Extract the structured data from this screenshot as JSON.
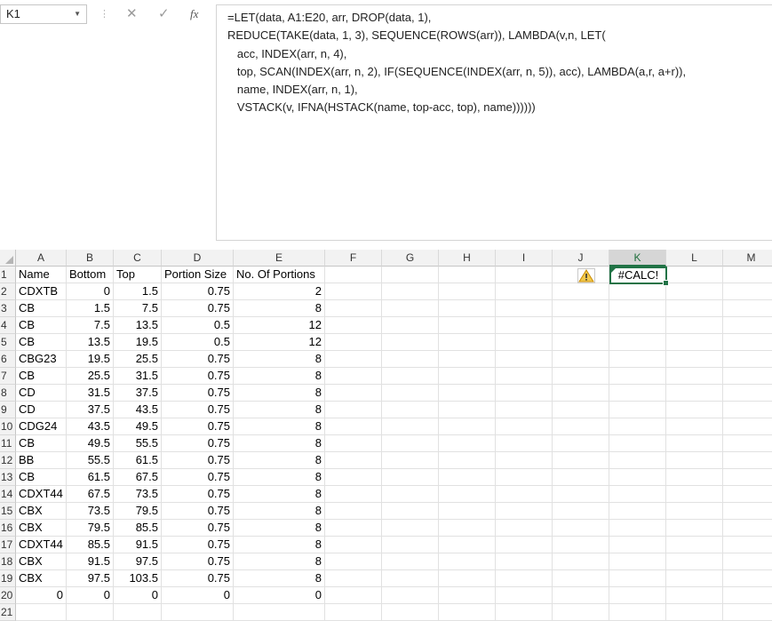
{
  "name_box": "K1",
  "formula_lines": [
    "=LET(data, A1:E20, arr, DROP(data, 1),",
    "REDUCE(TAKE(data, 1, 3), SEQUENCE(ROWS(arr)), LAMBDA(v,n, LET(",
    "   acc, INDEX(arr, n, 4),",
    "   top, SCAN(INDEX(arr, n, 2), IF(SEQUENCE(INDEX(arr, n, 5)), acc), LAMBDA(a,r, a+r)),",
    "   name, INDEX(arr, n, 1),",
    "   VSTACK(v, IFNA(HSTACK(name, top-acc, top), name))))))"
  ],
  "formula_icons": {
    "cancel": "✕",
    "enter": "✓",
    "fx": "fx"
  },
  "columns": [
    "A",
    "B",
    "C",
    "D",
    "E",
    "F",
    "G",
    "H",
    "I",
    "J",
    "K",
    "L",
    "M"
  ],
  "rows": [
    [
      "Name",
      "Bottom",
      "Top",
      "Portion Size",
      "No. Of Portions"
    ],
    [
      "CDXTB",
      "0",
      "1.5",
      "0.75",
      "2"
    ],
    [
      "CB",
      "1.5",
      "7.5",
      "0.75",
      "8"
    ],
    [
      "CB",
      "7.5",
      "13.5",
      "0.5",
      "12"
    ],
    [
      "CB",
      "13.5",
      "19.5",
      "0.5",
      "12"
    ],
    [
      "CBG23",
      "19.5",
      "25.5",
      "0.75",
      "8"
    ],
    [
      "CB",
      "25.5",
      "31.5",
      "0.75",
      "8"
    ],
    [
      "CD",
      "31.5",
      "37.5",
      "0.75",
      "8"
    ],
    [
      "CD",
      "37.5",
      "43.5",
      "0.75",
      "8"
    ],
    [
      "CDG24",
      "43.5",
      "49.5",
      "0.75",
      "8"
    ],
    [
      "CB",
      "49.5",
      "55.5",
      "0.75",
      "8"
    ],
    [
      "BB",
      "55.5",
      "61.5",
      "0.75",
      "8"
    ],
    [
      "CB",
      "61.5",
      "67.5",
      "0.75",
      "8"
    ],
    [
      "CDXT44",
      "67.5",
      "73.5",
      "0.75",
      "8"
    ],
    [
      "CBX",
      "73.5",
      "79.5",
      "0.75",
      "8"
    ],
    [
      "CBX",
      "79.5",
      "85.5",
      "0.75",
      "8"
    ],
    [
      "CDXT44",
      "85.5",
      "91.5",
      "0.75",
      "8"
    ],
    [
      "CBX",
      "91.5",
      "97.5",
      "0.75",
      "8"
    ],
    [
      "CBX",
      "97.5",
      "103.5",
      "0.75",
      "8"
    ],
    [
      "0",
      "0",
      "0",
      "0",
      "0"
    ],
    [
      "",
      "",
      "",
      "",
      ""
    ]
  ],
  "active_cell": {
    "ref": "K1",
    "value": "#CALC!"
  },
  "warning_icon": "warning-icon",
  "colors": {
    "accent": "#217346",
    "header_bg": "#f2f2f2",
    "selected_header_bg": "#d6d6d6",
    "gridline": "#e1e1e1"
  }
}
